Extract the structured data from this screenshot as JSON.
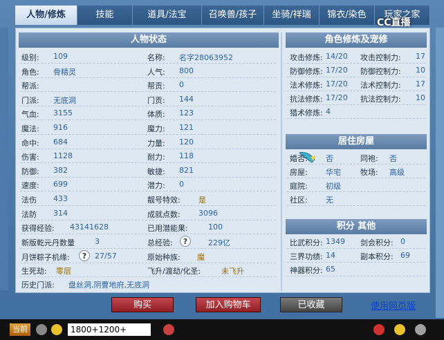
{
  "tabs": [
    {
      "label": "人物/修炼",
      "active": true
    },
    {
      "label": "技能"
    },
    {
      "label": "道具/法宝"
    },
    {
      "label": "召唤兽/孩子"
    },
    {
      "label": "坐骑/祥瑞"
    },
    {
      "label": "锦衣/染色"
    },
    {
      "label": "玩家之家"
    }
  ],
  "logo": "CC直播",
  "status": {
    "title": "人物状态",
    "rows_left": [
      {
        "label": "级别:",
        "value": "109"
      },
      {
        "label": "角色:",
        "value": "骨精灵"
      },
      {
        "label": "帮派:",
        "value": ""
      },
      {
        "label": "门派:",
        "value": "无底洞"
      },
      {
        "label": "气血:",
        "value": "3155"
      },
      {
        "label": "魔法:",
        "value": "916"
      },
      {
        "label": "命中:",
        "value": "684"
      },
      {
        "label": "伤害:",
        "value": "1128"
      },
      {
        "label": "防御:",
        "value": "382"
      },
      {
        "label": "速度:",
        "value": "699"
      },
      {
        "label": "法伤",
        "value": "433"
      },
      {
        "label": "法防",
        "value": "314"
      }
    ],
    "rows_right": [
      {
        "label": "名称:",
        "value": "名字28063952"
      },
      {
        "label": "人气:",
        "value": "800"
      },
      {
        "label": "帮贡:",
        "value": "0"
      },
      {
        "label": "门贡:",
        "value": "144"
      },
      {
        "label": "体质:",
        "value": "123"
      },
      {
        "label": "魔力:",
        "value": "121"
      },
      {
        "label": "力量:",
        "value": "120"
      },
      {
        "label": "耐力:",
        "value": "118"
      },
      {
        "label": "敏捷:",
        "value": "821"
      },
      {
        "label": "潜力:",
        "value": "0"
      },
      {
        "label": "靓号特效:",
        "value": "是"
      },
      {
        "label": "成就点数:",
        "value": "3096"
      }
    ],
    "exp_label": "获得经验:",
    "exp_value": "43141628",
    "potential_label": "已用潜能果:",
    "potential_value": "100",
    "qianyuan_label": "新版乾元丹数量",
    "qianyuan_value": "3",
    "total_exp_label": "总经验:",
    "total_exp_value": "229亿",
    "mooncake_label": "月饼粽子机缘:",
    "mooncake_value": "27/57",
    "race_label": "原始种族:",
    "race_value": "魔",
    "rebirth_label": "生死劫:",
    "rebirth_value": "零层",
    "fly_label": "飞升/渡劫/化圣:",
    "fly_value": "未飞升",
    "history_label": "历史门派:",
    "history_value": "盘丝洞,阴曹地府,无底洞",
    "help_mark": "?"
  },
  "cultivation": {
    "title": "角色修炼及宠修",
    "rows": [
      {
        "label": "攻击修炼:",
        "value": "14/20",
        "label2": "攻击控制力:",
        "value2": "17"
      },
      {
        "label": "防御修炼:",
        "value": "17/20",
        "label2": "防御控制力:",
        "value2": "10"
      },
      {
        "label": "法术修炼:",
        "value": "17/20",
        "label2": "法术控制力:",
        "value2": "17"
      },
      {
        "label": "抗法修炼:",
        "value": "17/20",
        "label2": "抗法控制力:",
        "value2": "10"
      },
      {
        "label": "猎术修炼:",
        "value": "4",
        "label2": "",
        "value2": ""
      }
    ]
  },
  "house": {
    "title": "居住房屋",
    "rows": [
      {
        "label": "婚否:",
        "value": "否",
        "label2": "同袍:",
        "value2": "否"
      },
      {
        "label": "房屋:",
        "value": "华宅",
        "label2": "牧场:",
        "value2": "高级"
      },
      {
        "label": "庭院:",
        "value": "初级",
        "label2": "",
        "value2": ""
      },
      {
        "label": "社区:",
        "value": "无",
        "label2": "",
        "value2": ""
      }
    ]
  },
  "score": {
    "title": "积分 其他",
    "rows": [
      {
        "label": "比武积分:",
        "value": "1349",
        "label2": "剑会积分:",
        "value2": "0"
      },
      {
        "label": "三界功绩:",
        "value": "14",
        "label2": "副本积分:",
        "value2": "69"
      },
      {
        "label": "神器积分:",
        "value": "65",
        "label2": "",
        "value2": ""
      }
    ]
  },
  "actions": {
    "buy": "购买",
    "cart": "加入购物车",
    "fav": "已收藏",
    "web": "使用网页版"
  },
  "taskbar": {
    "now": "当前",
    "input": "1800+1200+"
  }
}
